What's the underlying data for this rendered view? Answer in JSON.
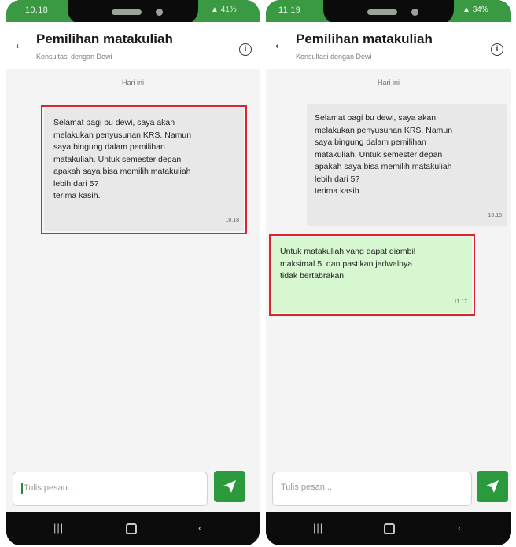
{
  "left_phone": {
    "status_time": "10.18",
    "status_indicators": "41%",
    "header": {
      "title": "Pemilihan matakuliah",
      "subtitle": "Konsultasi dengan Dewi",
      "back_icon": "arrow-left-icon",
      "info_icon": "info-icon"
    },
    "day_label": "Hari ini",
    "messages": [
      {
        "text": "Selamat pagi bu dewi, saya akan\nmelakukan penyusunan KRS. Namun\nsaya bingung dalam pemilihan\nmatakuliah. Untuk semester depan\napakah saya bisa memilih matakuliah\nlebih dari 5?\nterima kasih.",
        "time": "10.18",
        "highlighted": true
      }
    ],
    "input": {
      "placeholder": "Tulis pesan..."
    },
    "send_icon": "send-icon"
  },
  "right_phone": {
    "status_time": "11.19",
    "status_indicators": "34%",
    "header": {
      "title": "Pemilihan matakuliah",
      "subtitle": "Konsultasi dengan Dewi",
      "back_icon": "arrow-left-icon",
      "info_icon": "info-icon"
    },
    "day_label": "Hari ini",
    "messages": [
      {
        "text": "Selamat pagi bu dewi, saya akan\nmelakukan penyusunan KRS. Namun\nsaya bingung dalam pemilihan\nmatakuliah. Untuk semester depan\napakah saya bisa memilih matakuliah\nlebih dari 5?\nterima kasih.",
        "time": "10.18",
        "highlighted": false
      },
      {
        "text": "Untuk matakuliah yang dapat diambil\nmaksimal 5. dan pastikan jadwalnya\ntidak bertabrakan",
        "time": "11.17",
        "highlighted": true
      }
    ],
    "input": {
      "placeholder": "Tulis pesan..."
    },
    "send_icon": "send-icon"
  },
  "nav_icons": [
    "recent-apps-icon",
    "home-icon",
    "back-nav-icon"
  ],
  "colors": {
    "status_bar": "#3a9a44",
    "send_button": "#2b9a3c",
    "highlight_border": "#d9252f",
    "incoming_bubble": "#e8e8e8",
    "reply_bubble": "#d6f7cf"
  }
}
